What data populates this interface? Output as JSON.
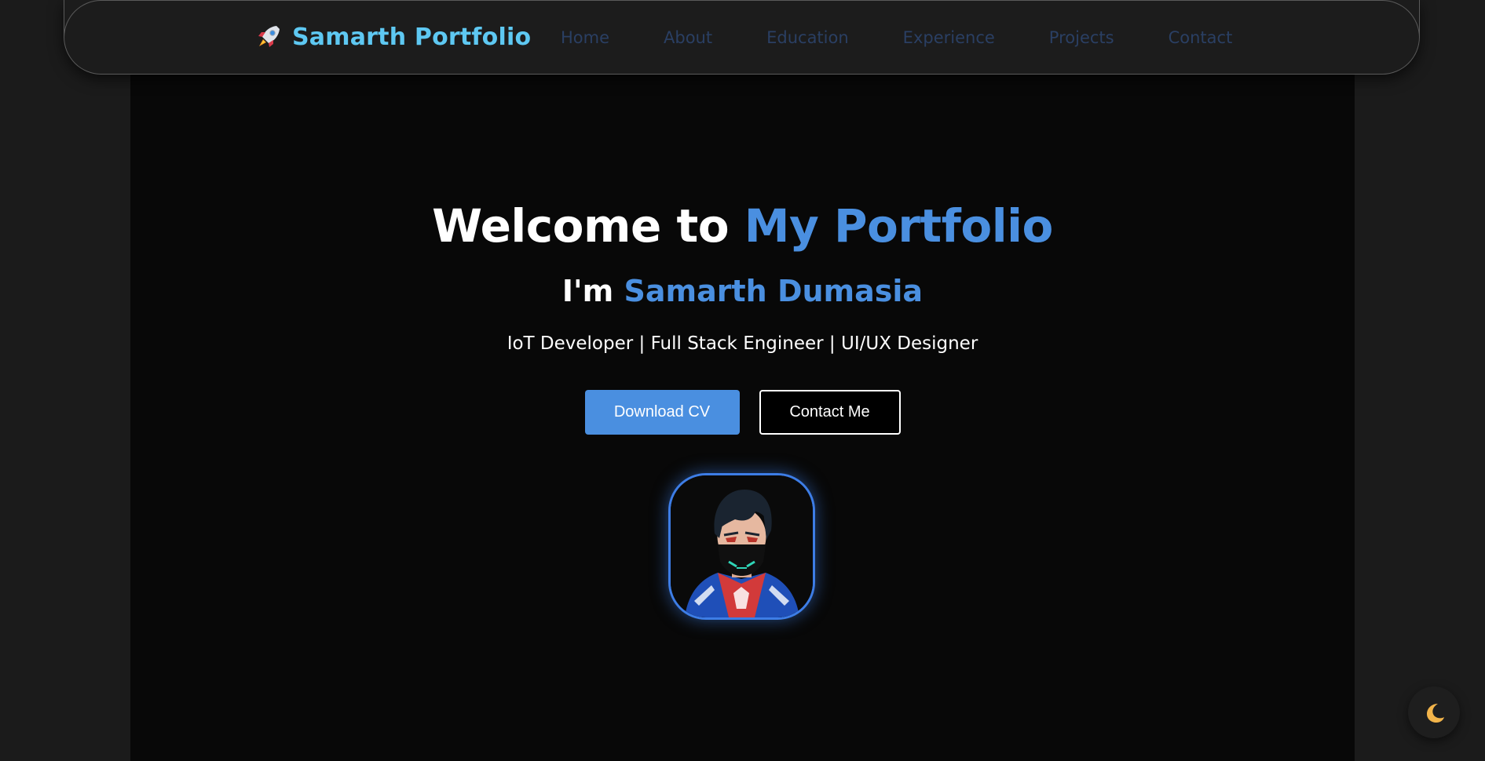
{
  "nav": {
    "brand": "Samarth Portfolio",
    "brand_icon": "rocket-icon",
    "links": [
      {
        "label": "Home"
      },
      {
        "label": "About"
      },
      {
        "label": "Education"
      },
      {
        "label": "Experience"
      },
      {
        "label": "Projects"
      },
      {
        "label": "Contact"
      }
    ]
  },
  "hero": {
    "title_prefix": "Welcome to ",
    "title_accent": "My Portfolio",
    "name_prefix": "I'm ",
    "name_accent": "Samarth Dumasia",
    "tagline": "IoT Developer | Full Stack Engineer | UI/UX Designer",
    "download_button": "Download CV",
    "contact_button": "Contact Me",
    "avatar": "profile-avatar"
  },
  "theme_toggle": {
    "icon": "moon-icon"
  },
  "colors": {
    "accent": "#4a8fe0",
    "brand": "#5ec8f2",
    "nav_link": "#2a3f63",
    "background": "#080808"
  }
}
